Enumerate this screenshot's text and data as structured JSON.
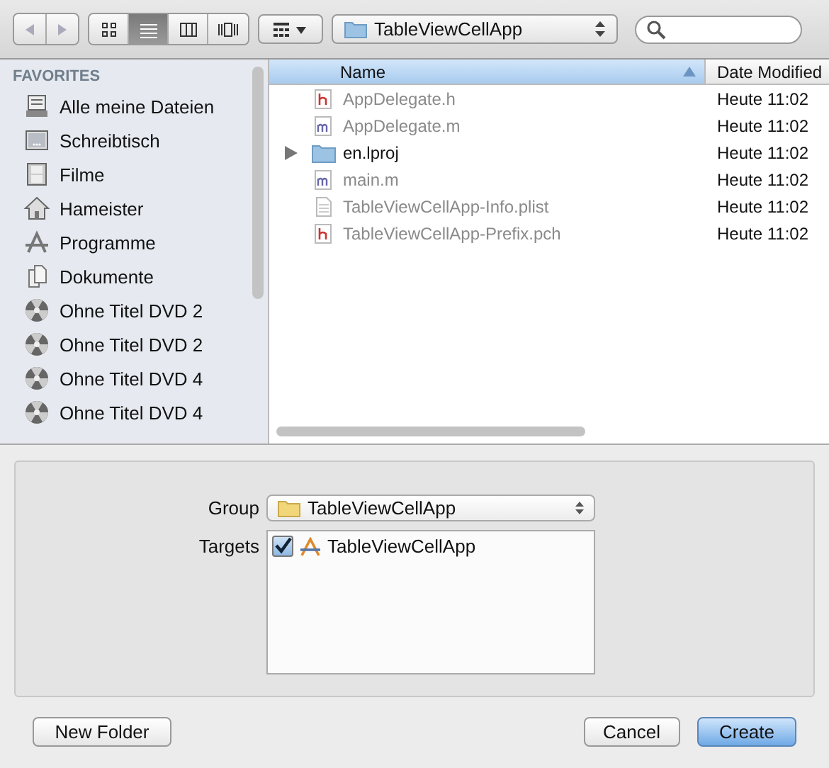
{
  "toolbar": {
    "view_modes": [
      {
        "kind": "icons",
        "selected": false
      },
      {
        "kind": "list",
        "selected": true
      },
      {
        "kind": "columns",
        "selected": false
      },
      {
        "kind": "coverflow",
        "selected": false
      }
    ],
    "location": "TableViewCellApp"
  },
  "sidebar": {
    "heading": "FAVORITES",
    "items": [
      {
        "kind": "files",
        "label": "Alle meine Dateien"
      },
      {
        "kind": "desktop",
        "label": "Schreibtisch"
      },
      {
        "kind": "movies",
        "label": "Filme"
      },
      {
        "kind": "home",
        "label": "Hameister"
      },
      {
        "kind": "apps",
        "label": "Programme"
      },
      {
        "kind": "documents",
        "label": "Dokumente"
      },
      {
        "kind": "disc",
        "label": "Ohne Titel DVD 2"
      },
      {
        "kind": "disc",
        "label": "Ohne Titel DVD 2"
      },
      {
        "kind": "disc",
        "label": "Ohne Titel DVD 4"
      },
      {
        "kind": "disc",
        "label": "Ohne Titel DVD 4"
      }
    ]
  },
  "file_list": {
    "columns": [
      {
        "label": "Name",
        "selected": true
      },
      {
        "label": "Date Modified",
        "selected": false
      }
    ],
    "rows": [
      {
        "kind": "h",
        "name": "AppDelegate.h",
        "date": "Heute 11:02",
        "disabled": true
      },
      {
        "kind": "m",
        "name": "AppDelegate.m",
        "date": "Heute 11:02",
        "disabled": true
      },
      {
        "kind": "folder",
        "name": "en.lproj",
        "date": "Heute 11:02",
        "disabled": false
      },
      {
        "kind": "m",
        "name": "main.m",
        "date": "Heute 11:02",
        "disabled": true
      },
      {
        "kind": "plist",
        "name": "TableViewCellApp-Info.plist",
        "date": "Heute 11:02",
        "disabled": true
      },
      {
        "kind": "h",
        "name": "TableViewCellApp-Prefix.pch",
        "date": "Heute 11:02",
        "disabled": true
      }
    ]
  },
  "options": {
    "group_label": "Group",
    "group_value": "TableViewCellApp",
    "targets_label": "Targets",
    "targets": [
      {
        "label": "TableViewCellApp",
        "checked": true
      }
    ]
  },
  "buttons": {
    "new_folder": "New Folder",
    "cancel": "Cancel",
    "create": "Create"
  }
}
